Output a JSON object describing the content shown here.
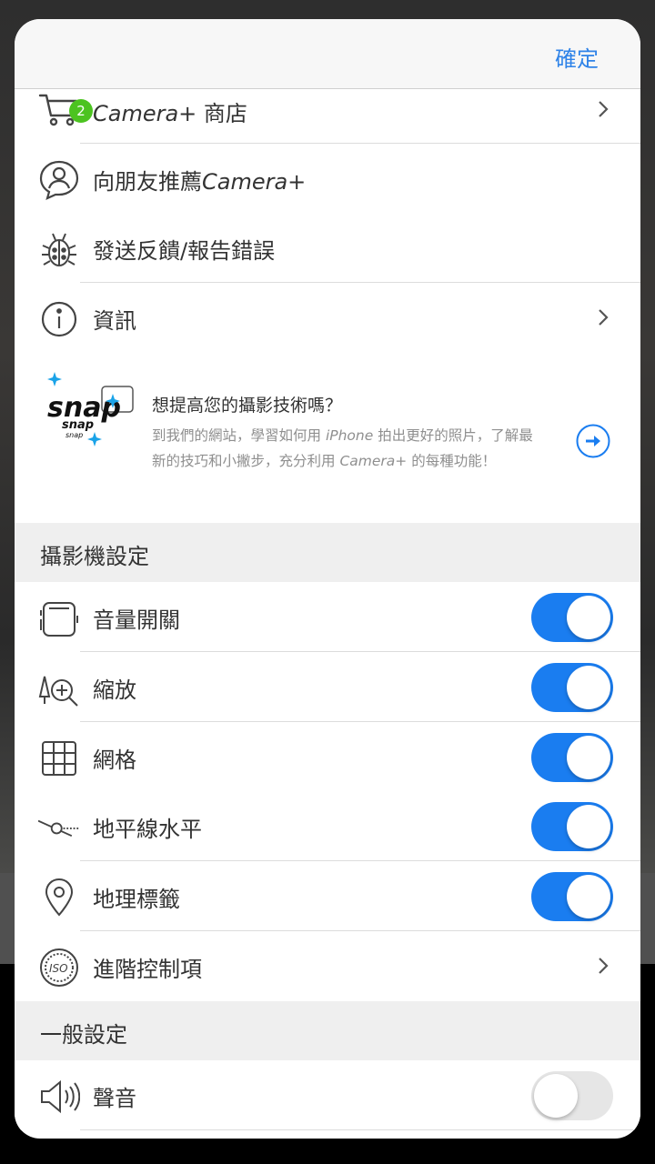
{
  "header": {
    "done_label": "確定"
  },
  "menu": {
    "store": {
      "label_italic": "Camera+",
      "label_rest": " 商店",
      "badge": "2"
    },
    "recommend": {
      "label_pre": "向朋友推薦",
      "label_italic": "Camera+"
    },
    "feedback": {
      "label": "發送反饋/報告錯誤"
    },
    "info": {
      "label": "資訊"
    }
  },
  "promo": {
    "logo_text": "snap",
    "title": "想提高您的攝影技術嗎？",
    "body_1": "到我們的網站，學習如何用 ",
    "body_iphone": "iPhone",
    "body_2": " 拍出更好的照片，了解最新的技巧和小撇步，充分利用 ",
    "body_camera": "Camera+",
    "body_3": " 的每種功能！"
  },
  "camera_settings": {
    "header": "攝影機設定",
    "items": [
      {
        "label": "音量開關",
        "icon": "phone-volume-icon",
        "on": true
      },
      {
        "label": "縮放",
        "icon": "zoom-icon",
        "on": true
      },
      {
        "label": "網格",
        "icon": "grid-icon",
        "on": true
      },
      {
        "label": "地平線水平",
        "icon": "horizon-level-icon",
        "on": true
      },
      {
        "label": "地理標籤",
        "icon": "location-pin-icon",
        "on": true
      }
    ],
    "advanced": {
      "label": "進階控制項",
      "icon": "iso-icon"
    }
  },
  "general_settings": {
    "header": "一般設定",
    "items": [
      {
        "label": "聲音",
        "icon": "speaker-icon",
        "on": false
      }
    ]
  },
  "colors": {
    "accent": "#1a7df0",
    "badge": "#4cc320",
    "link": "#2f83e8"
  }
}
